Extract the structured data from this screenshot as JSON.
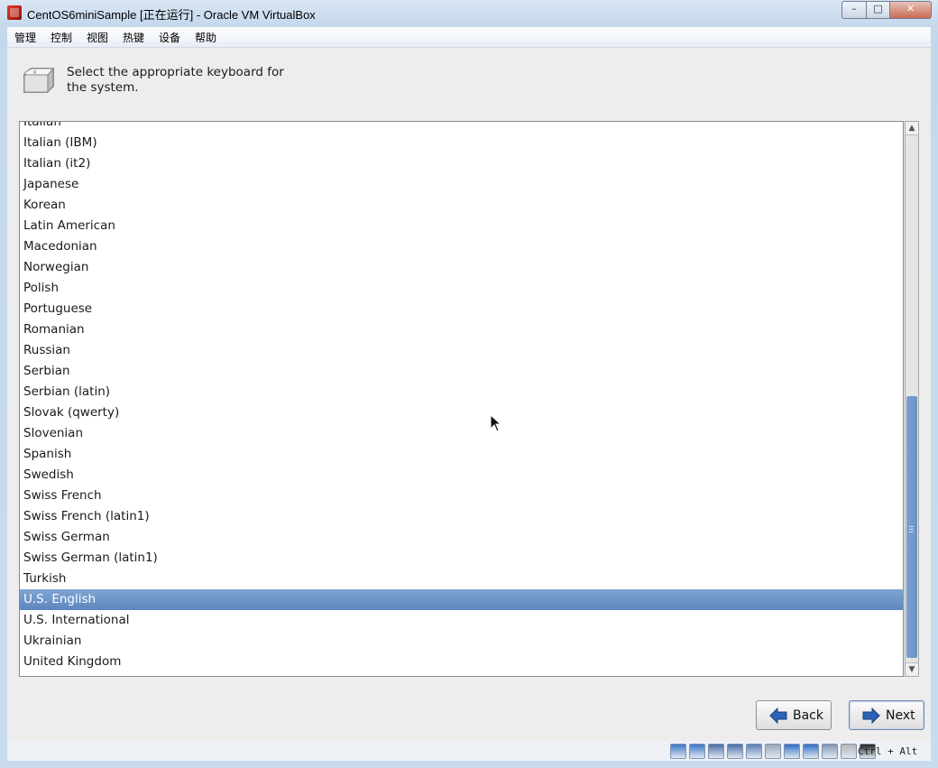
{
  "window": {
    "title": "CentOS6miniSample [正在运行] - Oracle VM VirtualBox",
    "controls": {
      "minimize": "▭",
      "maximize": "□",
      "close": "✕"
    }
  },
  "menubar": {
    "items": [
      "管理",
      "控制",
      "视图",
      "热键",
      "设备",
      "帮助"
    ]
  },
  "installer": {
    "prompt": "Select the appropriate keyboard for the system.",
    "keyboard_list": [
      "Italian",
      "Italian (IBM)",
      "Italian (it2)",
      "Japanese",
      "Korean",
      "Latin American",
      "Macedonian",
      "Norwegian",
      "Polish",
      "Portuguese",
      "Romanian",
      "Russian",
      "Serbian",
      "Serbian (latin)",
      "Slovak (qwerty)",
      "Slovenian",
      "Spanish",
      "Swedish",
      "Swiss French",
      "Swiss French (latin1)",
      "Swiss German",
      "Swiss German (latin1)",
      "Turkish",
      "U.S. English",
      "U.S. International",
      "Ukrainian",
      "United Kingdom"
    ],
    "selected": "U.S. English",
    "buttons": {
      "back": "Back",
      "next": "Next"
    }
  },
  "statusbar": {
    "host_key": "Ctrl + Alt",
    "icons": [
      "hard-disk-icon",
      "optical-drive-icon",
      "audio-icon",
      "network-icon",
      "usb-icon",
      "shared-folders-icon",
      "display-icon",
      "video-capture-icon",
      "cpu-icon",
      "mouse-integration-icon",
      "keyboard-capture-icon"
    ]
  },
  "colors": {
    "selection": "#5d87bf",
    "scroll_thumb": "#6a90c6",
    "arrow_blue": "#2b63b8"
  }
}
